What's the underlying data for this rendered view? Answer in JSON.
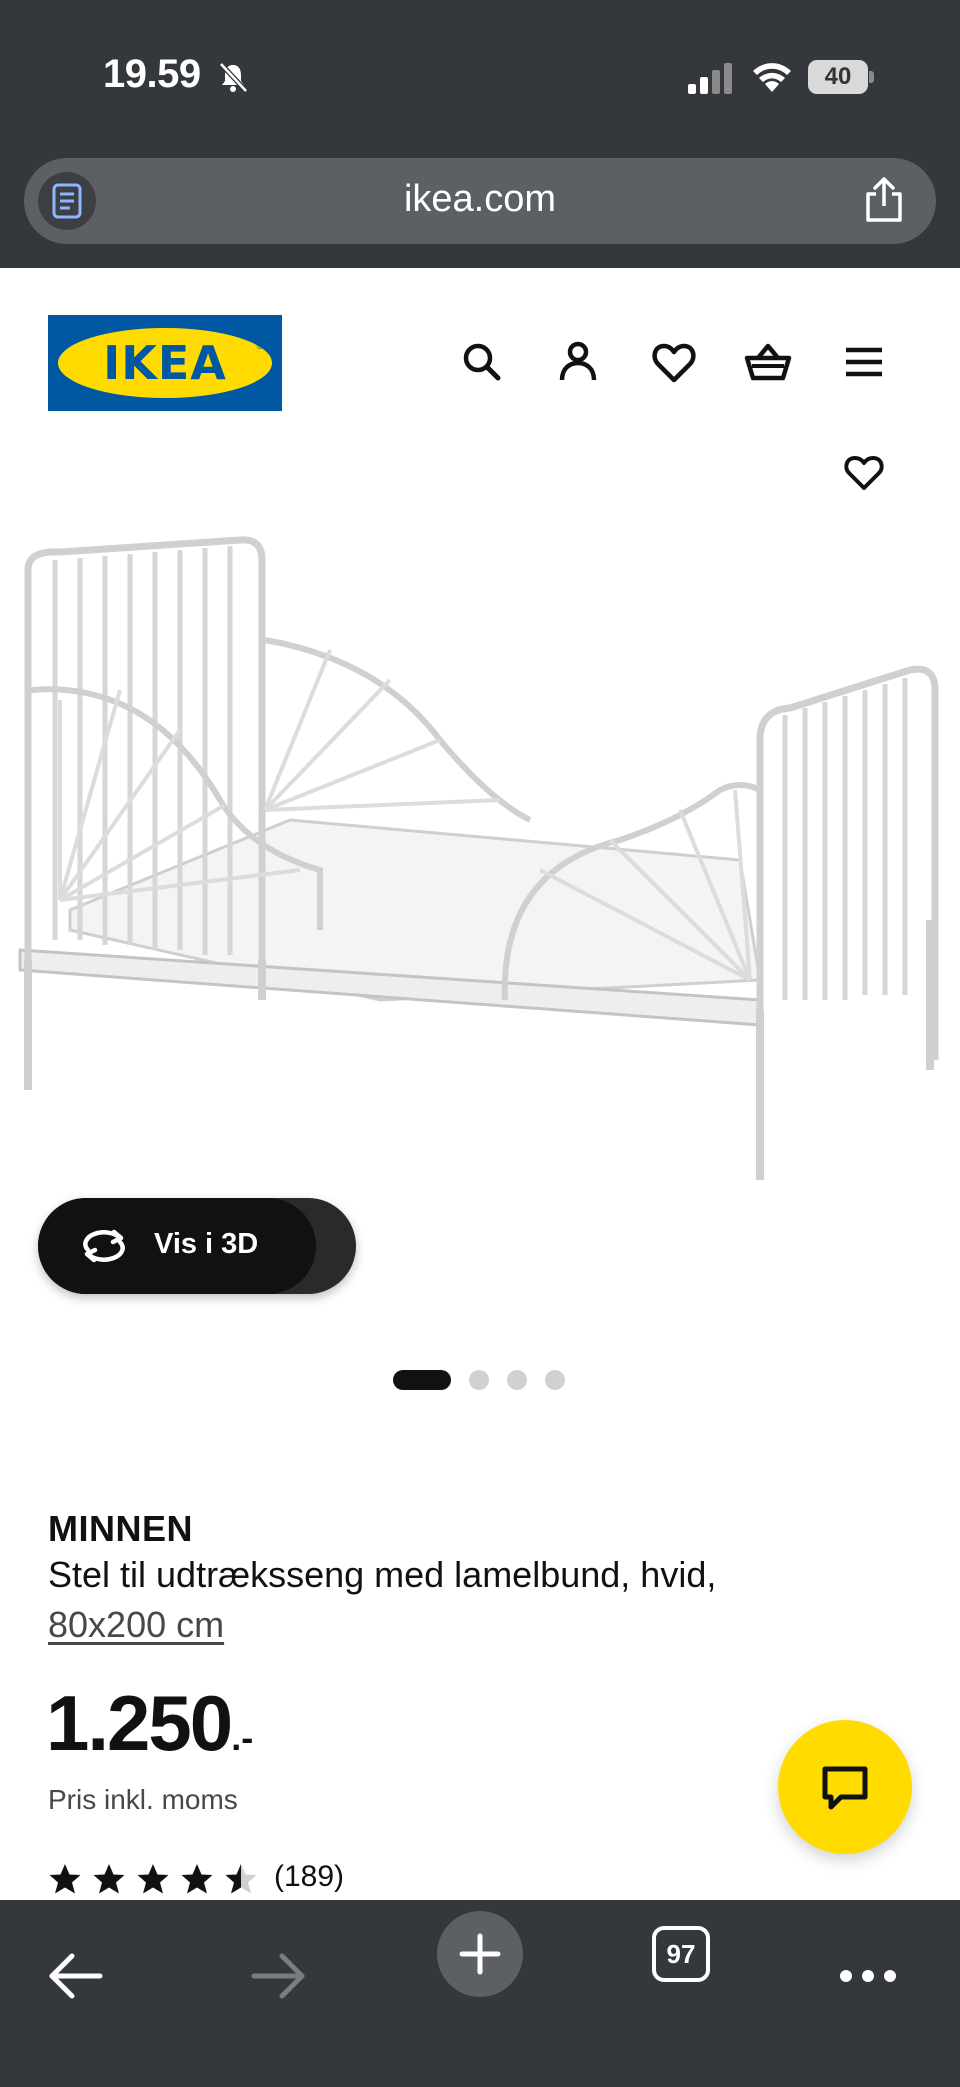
{
  "status_bar": {
    "time": "19.59",
    "battery_level": "40"
  },
  "browser": {
    "url": "ikea.com"
  },
  "header": {
    "logo_text": "IKEA",
    "icons": [
      "search-icon",
      "account-icon",
      "heart-icon",
      "basket-icon",
      "menu-icon"
    ]
  },
  "gallery": {
    "view_3d_label": "Vis i 3D",
    "image_count": 4,
    "active_image": 1
  },
  "product": {
    "name": "MINNEN",
    "description": "Stel til udtræksseng med lamelbund, hvid,",
    "size": "80x200 cm",
    "price_integer": "1.250",
    "price_suffix": ".-",
    "price_note": "Pris inkl. moms",
    "rating": 4.5,
    "rating_count": "(189)"
  },
  "toolbar": {
    "tabs_count": "97"
  },
  "colors": {
    "ikea_blue": "#0058a3",
    "ikea_yellow": "#ffdb00",
    "chrome_dark": "#34373b"
  }
}
